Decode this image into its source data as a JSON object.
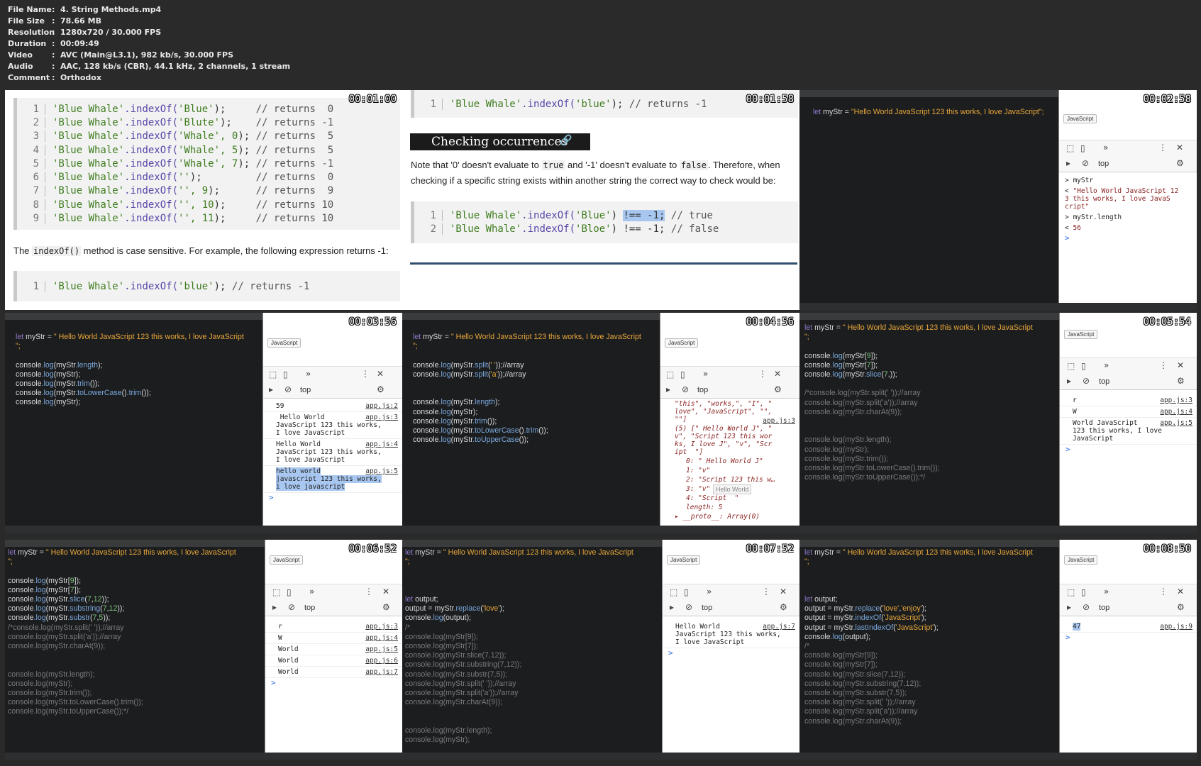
{
  "meta": [
    {
      "key": "File Name",
      "value": "4. String Methods.mp4"
    },
    {
      "key": "File Size",
      "value": "78.66 MB"
    },
    {
      "key": "Resolution",
      "value": "1280x720 / 30.000 FPS"
    },
    {
      "key": "Duration",
      "value": "00:09:49"
    },
    {
      "key": "Video",
      "value": "AVC (Main@L3.1), 982 kb/s, 30.000 FPS"
    },
    {
      "key": "Audio",
      "value": "AAC, 128 kb/s (CBR), 44.1 kHz, 2 channels, 1 stream"
    },
    {
      "key": "Comment",
      "value": "Orthodox"
    }
  ],
  "colon": ":",
  "timestamps": [
    "00:01:00",
    "00:01:58",
    "00:02:58",
    "00:03:56",
    "00:04:56",
    "00:05:54",
    "00:06:52",
    "00:07:52",
    "00:08:50"
  ],
  "t1": {
    "lines": [
      {
        "n": "1",
        "a": "'Blue Whale'",
        "b": ".indexOf(",
        "c": "'Blue'",
        "d": ");     ",
        "e": "// returns  0"
      },
      {
        "n": "2",
        "a": "'Blue Whale'",
        "b": ".indexOf(",
        "c": "'Blute'",
        "d": ");    ",
        "e": "// returns -1"
      },
      {
        "n": "3",
        "a": "'Blue Whale'",
        "b": ".indexOf(",
        "c": "'Whale', 0",
        "d": "); ",
        "e": "// returns  5"
      },
      {
        "n": "4",
        "a": "'Blue Whale'",
        "b": ".indexOf(",
        "c": "'Whale', 5",
        "d": "); ",
        "e": "// returns  5"
      },
      {
        "n": "5",
        "a": "'Blue Whale'",
        "b": ".indexOf(",
        "c": "'Whale', 7",
        "d": "); ",
        "e": "// returns -1"
      },
      {
        "n": "6",
        "a": "'Blue Whale'",
        "b": ".indexOf(",
        "c": "''",
        "d": ");         ",
        "e": "// returns  0"
      },
      {
        "n": "7",
        "a": "'Blue Whale'",
        "b": ".indexOf(",
        "c": "'', 9",
        "d": ");      ",
        "e": "// returns  9"
      },
      {
        "n": "8",
        "a": "'Blue Whale'",
        "b": ".indexOf(",
        "c": "'', 10",
        "d": ");     ",
        "e": "// returns 10"
      },
      {
        "n": "9",
        "a": "'Blue Whale'",
        "b": ".indexOf(",
        "c": "'', 11",
        "d": ");     ",
        "e": "// returns 10"
      }
    ],
    "para_pre": "The ",
    "para_code": "indexOf()",
    "para_post": " method is case sensitive. For example, the following expression returns -1:",
    "single": {
      "n": "1",
      "a": "'Blue Whale'",
      "b": ".indexOf(",
      "c": "'blue'",
      "d": "); ",
      "e": "// returns -1"
    }
  },
  "t2": {
    "top": {
      "n": "1",
      "a": "'Blue Whale'",
      "b": ".indexOf(",
      "c": "'blue'",
      "d": "); ",
      "e": "// returns -1"
    },
    "heading": "Checking occurrences",
    "link_icon": "🔗",
    "p1": "Note that '0' doesn't evaluate to ",
    "c1": "true",
    "p2": " and '-1' doesn't evaluate to ",
    "c2": "false",
    "p3": ". Therefore, when checking if a specific string exists within another string the correct way to check would be:",
    "l1": {
      "n": "1",
      "a": "'Blue Whale'",
      "b": ".indexOf(",
      "c": "'Blue'",
      "d": ") ",
      "sel": "!== -1;",
      "e": " // true"
    },
    "l2": {
      "n": "2",
      "a": "'Blue Whale'",
      "b": ".indexOf(",
      "c": "'Bloe'",
      "d": ") !== -1; ",
      "e": "// false"
    }
  },
  "decl": {
    "kw": "let",
    "name": " myStr = ",
    "val": "\" Hello World JavaScript 123 this works, I love JavaScript",
    "end": "\";"
  },
  "decl3": {
    "kw": "let",
    "name": " myStr = ",
    "val": "\"Hello World JavaScript 123 this works, I love JavaScript\";"
  },
  "dt": {
    "tab": "JavaScript",
    "ctx": "top",
    "prompt": ">"
  },
  "t3": {
    "rows": [
      {
        "p": "> ",
        "t": "myStr"
      },
      {
        "p": "< ",
        "t": "\"Hello World JavaScript 12\n3 this works, I love JavaS\ncript\""
      },
      {
        "p": "> ",
        "t": "myStr.length"
      },
      {
        "p": "< ",
        "t": "56"
      }
    ]
  },
  "t4": {
    "code": [
      "console.log(myStr.length);",
      "console.log(myStr);",
      "console.log(myStr.trim());",
      "console.log(myStr.toLowerCase().trim());",
      "console.log(myStr);"
    ],
    "rows": [
      {
        "t": "59",
        "src": "app.js:2"
      },
      {
        "t": " Hello World\nJavaScript 123 this works,\nI love JavaScript",
        "src": "app.js:3"
      },
      {
        "t": "Hello World\nJavaScript 123 this works,\nI love JavaScript",
        "src": "app.js:4"
      },
      {
        "t": "hello world\njavascript 123 this works,\ni love javascript",
        "src": "app.js:5"
      }
    ]
  },
  "t5": {
    "code": [
      "console.log(myStr.split(' '));//array",
      "console.log(myStr.split('a'));//array",
      "",
      "",
      "console.log(myStr.length);",
      "console.log(myStr);",
      "console.log(myStr.trim());",
      "console.log(myStr.toLowerCase().trim());",
      "console.log(myStr.toUpperCase());"
    ],
    "rows": [
      "\"this\", \"works,\", \"I\", \"\nlove\", \"JavaScript\", \"\",\n\"\"]",
      "(5) [\" Hello World J\", \"\nv\", \"Script 123 this wor\nks, I love J\", \"v\", \"Scr\nipt  \"]",
      "0: \" Hello World J\"",
      "1: \"v\"",
      "2: \"Script 123 this w…",
      "3: \"v\"",
      "4: \"Script  \"",
      "length: 5",
      "▸ __proto__: Array(0)"
    ],
    "src": "app.js:3",
    "tooltip": "Hello World"
  },
  "t6": {
    "code": [
      "console.log(myStr[9]);",
      "console.log(myStr[7]);",
      "console.log(myStr.slice(7,));",
      "",
      "/*console.log(myStr.split(' '));//array",
      "console.log(myStr.split('a'));//array",
      "console.log(myStr.charAt(9));",
      "",
      "",
      "console.log(myStr.length);",
      "console.log(myStr);",
      "console.log(myStr.trim());",
      "console.log(myStr.toLowerCase().trim());",
      "console.log(myStr.toUpperCase());*/"
    ],
    "rows": [
      {
        "t": "r",
        "src": "app.js:3"
      },
      {
        "t": "W",
        "src": "app.js:4"
      },
      {
        "t": "World JavaScript\n123 this works, I love\nJavaScript",
        "src": "app.js:5"
      }
    ]
  },
  "t7": {
    "code": [
      "console.log(myStr[9]);",
      "console.log(myStr[7]);",
      "console.log(myStr.slice(7,12));",
      "console.log(myStr.substring(7,12));",
      "console.log(myStr.substr(7,5));",
      "/*console.log(myStr.split(' '));//array",
      "console.log(myStr.split('a'));//array",
      "console.log(myStr.charAt(9));",
      "",
      "",
      "console.log(myStr.length);",
      "console.log(myStr);",
      "console.log(myStr.trim());",
      "console.log(myStr.toLowerCase().trim());",
      "console.log(myStr.toUpperCase());*/"
    ],
    "rows": [
      {
        "t": "r",
        "src": "app.js:3"
      },
      {
        "t": "W",
        "src": "app.js:4"
      },
      {
        "t": "World",
        "src": "app.js:5"
      },
      {
        "t": "World",
        "src": "app.js:6"
      },
      {
        "t": "World",
        "src": "app.js:7"
      }
    ]
  },
  "t8": {
    "code": [
      "",
      "",
      "let output;",
      "output = myStr.replace('love');",
      "console.log(output);",
      "/*",
      "console.log(myStr[9]);",
      "console.log(myStr[7]);",
      "console.log(myStr.slice(7,12));",
      "console.log(myStr.substring(7,12));",
      "console.log(myStr.substr(7,5));",
      "console.log(myStr.split(' '));//array",
      "console.log(myStr.split('a'));//array",
      "console.log(myStr.charAt(9));",
      "",
      "",
      "console.log(myStr.length);",
      "console.log(myStr);"
    ],
    "rows": [
      {
        "t": "Hello World\nJavaScript 123 this works,\nI love JavaScript",
        "src": "app.js:7"
      }
    ]
  },
  "t9": {
    "code": [
      "",
      "",
      "let output;",
      "output = myStr.replace('love','enjoy');",
      "output = myStr.indexOf('JavaScript');",
      "output = myStr.lastIndexOf('JavaScript');",
      "console.log(output);",
      "/*",
      "console.log(myStr[9]);",
      "console.log(myStr[7]);",
      "console.log(myStr.slice(7,12));",
      "console.log(myStr.substring(7,12));",
      "console.log(myStr.substr(7,5));",
      "console.log(myStr.split(' '));//array",
      "console.log(myStr.split('a'));//array",
      "console.log(myStr.charAt(9));"
    ],
    "rows": [
      {
        "t": "47",
        "src": "app.js:9"
      }
    ]
  }
}
